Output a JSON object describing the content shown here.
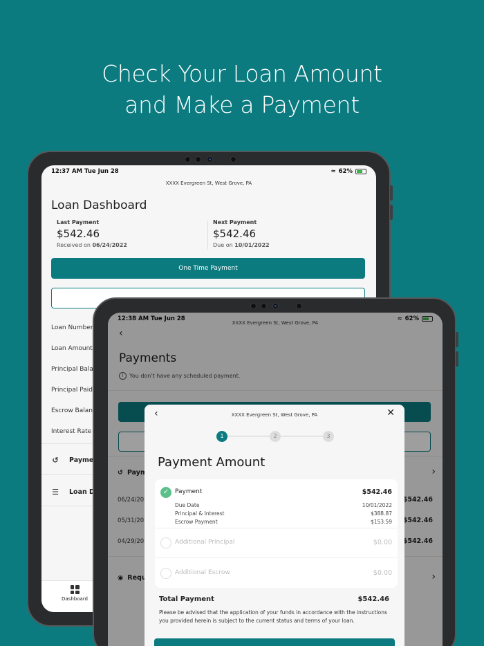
{
  "headline": {
    "line1": "Check Your Loan Amount",
    "line2": "and Make a Payment"
  },
  "tablet1": {
    "status": {
      "time": "12:37 AM   Tue Jun 28",
      "battery": "62%"
    },
    "address": "XXXX Evergreen St, West Grove, PA",
    "title": "Loan Dashboard",
    "last_payment": {
      "label": "Last Payment",
      "amount": "$542.46",
      "sub_prefix": "Received on ",
      "sub_date": "06/24/2022"
    },
    "next_payment": {
      "label": "Next Payment",
      "amount": "$542.46",
      "sub_prefix": "Due on ",
      "sub_date": "10/01/2022"
    },
    "one_time_button": "One Time Payment",
    "rows": [
      "Loan Number",
      "Loan Amount",
      "Principal Balar",
      "Principal Paid",
      "Escrow Balanc",
      "Interest Rate"
    ],
    "menu": [
      {
        "icon": "history-icon",
        "label": "Paymen"
      },
      {
        "icon": "list-icon",
        "label": "Loan De"
      }
    ],
    "tab_dashboard": "Dashboard"
  },
  "tablet2": {
    "status": {
      "time": "12:38 AM   Tue Jun 28",
      "battery": "62%"
    },
    "address": "XXXX Evergreen St, West Grove, PA",
    "title": "Payments",
    "note": "You don't have any scheduled payment.",
    "history_label": "Paym",
    "history": [
      {
        "date": "06/24/202",
        "amount": "$542.46"
      },
      {
        "date": "05/31/202",
        "amount": "$542.46"
      },
      {
        "date": "04/29/202",
        "amount": "$542.46"
      }
    ],
    "request_label": "Requ"
  },
  "modal": {
    "address": "XXXX Evergreen St, West Grove, PA",
    "steps": [
      "1",
      "2",
      "3"
    ],
    "title": "Payment Amount",
    "payment": {
      "label": "Payment",
      "amount": "$542.46",
      "details": [
        {
          "label": "Due Date",
          "value": "10/01/2022"
        },
        {
          "label": "Principal & Interest",
          "value": "$388.87"
        },
        {
          "label": "Escrow Payment",
          "value": "$153.59"
        }
      ]
    },
    "additional_principal": {
      "label": "Additional Principal",
      "amount": "$0.00"
    },
    "additional_escrow": {
      "label": "Additional Escrow",
      "amount": "$0.00"
    },
    "total": {
      "label": "Total Payment",
      "amount": "$542.46"
    },
    "disclaimer": "Please be advised that the application of your funds in accordance with the instructions you provided herein is subject to the current status and terms of your loan."
  },
  "colors": {
    "brand": "#0c7b80",
    "check": "#5cc08a"
  }
}
